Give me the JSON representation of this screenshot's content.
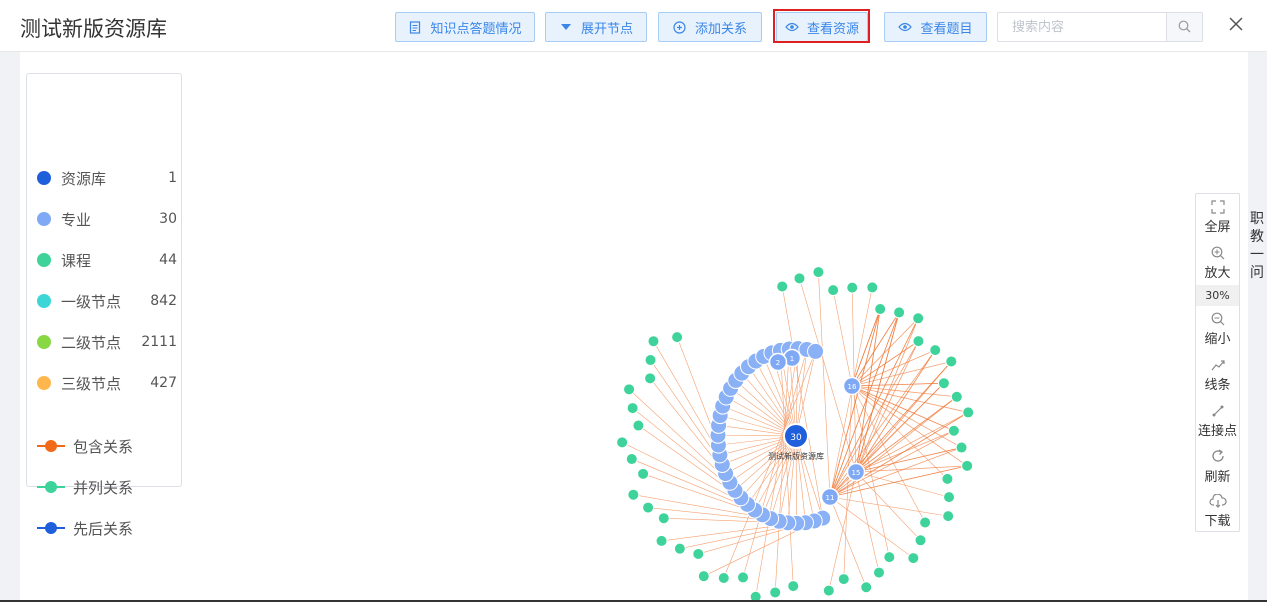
{
  "header": {
    "title": "测试新版资源库",
    "buttons": {
      "answers": "知识点答题情况",
      "expand": "展开节点",
      "add_relation": "添加关系",
      "view_resources": "查看资源",
      "view_questions": "查看题目"
    },
    "search_placeholder": "搜索内容"
  },
  "legend": {
    "nodes": [
      {
        "label": "资源库",
        "count": "1",
        "color": "#1f5fdc"
      },
      {
        "label": "专业",
        "count": "30",
        "color": "#7fa9f5"
      },
      {
        "label": "课程",
        "count": "44",
        "color": "#3ed39a"
      },
      {
        "label": "一级节点",
        "count": "842",
        "color": "#3dd6d6"
      },
      {
        "label": "二级节点",
        "count": "2111",
        "color": "#88d844"
      },
      {
        "label": "三级节点",
        "count": "427",
        "color": "#ffb74d"
      }
    ],
    "relations": [
      {
        "label": "包含关系",
        "color": "#f06a1a"
      },
      {
        "label": "并列关系",
        "color": "#3ed39a"
      },
      {
        "label": "先后关系",
        "color": "#1f5fdc"
      }
    ]
  },
  "toolbar": {
    "fullscreen": "全屏",
    "zoom_in": "放大",
    "zoom_level": "30%",
    "zoom_out": "缩小",
    "lines": "线条",
    "connect": "连接点",
    "refresh": "刷新",
    "download": "下载"
  },
  "side_text": [
    "职",
    "教",
    "一",
    "问"
  ],
  "graph": {
    "center_value": "30",
    "center_label": "测试新版资源库",
    "hub_nodes": [
      "16",
      "15",
      "11",
      "1",
      "2"
    ]
  }
}
